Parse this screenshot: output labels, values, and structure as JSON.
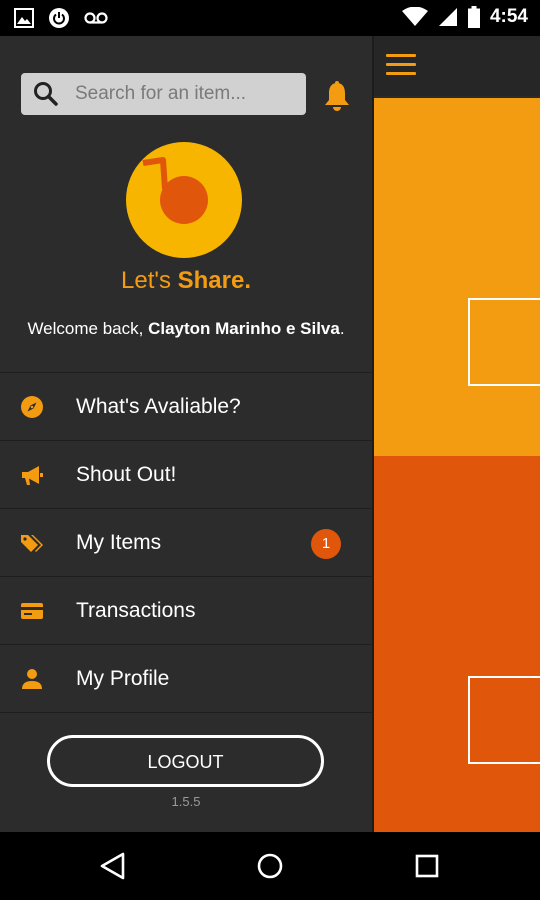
{
  "status_bar": {
    "time": "4:54",
    "left_icons": [
      "image-icon",
      "power-circle-icon",
      "voicemail-icon"
    ],
    "right_icons": [
      "wifi-icon",
      "signal-icon",
      "battery-icon"
    ]
  },
  "drawer": {
    "search": {
      "placeholder": "Search for an item..."
    },
    "tagline": {
      "prefix": "Let's ",
      "bold": "Share."
    },
    "welcome": {
      "prefix": "Welcome back, ",
      "name": "Clayton Marinho e Silva",
      "suffix": "."
    },
    "menu": [
      {
        "label": "What's Avaliable?",
        "icon": "compass-icon"
      },
      {
        "label": "Shout Out!",
        "icon": "megaphone-icon"
      },
      {
        "label": "My Items",
        "icon": "tags-icon",
        "badge": "1"
      },
      {
        "label": "Transactions",
        "icon": "credit-card-icon"
      },
      {
        "label": "My Profile",
        "icon": "person-icon"
      }
    ],
    "logout_label": "LOGOUT",
    "version": "1.5.5"
  },
  "main": {
    "tile_colors": [
      "#f39c12",
      "#e0570c"
    ]
  },
  "colors": {
    "accent": "#f39c12",
    "accent_dark": "#e0570c",
    "drawer_bg": "#2c2c2c",
    "logo_yellow": "#f7b500"
  },
  "nav_bar": {
    "buttons": [
      "back-triangle-icon",
      "home-circle-icon",
      "recents-square-icon"
    ]
  }
}
